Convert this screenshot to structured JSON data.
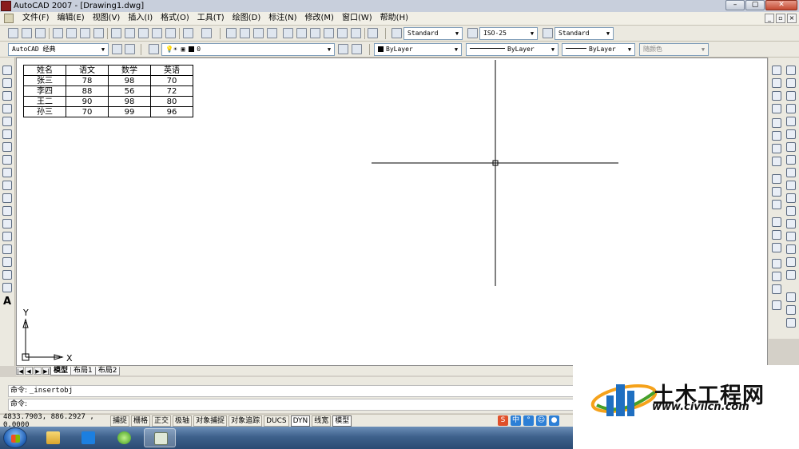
{
  "window": {
    "title": "AutoCAD 2007 - [Drawing1.dwg]",
    "min_label": "–",
    "max_label": "▢",
    "close_label": "✕"
  },
  "menu": {
    "items": [
      "文件(F)",
      "编辑(E)",
      "视图(V)",
      "插入(I)",
      "格式(O)",
      "工具(T)",
      "绘图(D)",
      "标注(N)",
      "修改(M)",
      "窗口(W)",
      "帮助(H)"
    ],
    "mdi": [
      "_",
      "▫",
      "×"
    ]
  },
  "toolbar_standard": {
    "text_style": "Standard",
    "dim_style": "ISO-25",
    "table_style": "Standard"
  },
  "toolbar_layers": {
    "workspace": "AutoCAD 经典",
    "layer": "0",
    "color": "ByLayer",
    "linetype": "ByLayer",
    "lineweight": "ByLayer",
    "plotstyle": "随颜色"
  },
  "drawing": {
    "table": {
      "rows": [
        [
          "姓名",
          "语文",
          "数学",
          "英语"
        ],
        [
          "张三",
          "78",
          "98",
          "70"
        ],
        [
          "李四",
          "88",
          "56",
          "72"
        ],
        [
          "王二",
          "90",
          "98",
          "80"
        ],
        [
          "孙三",
          "70",
          "99",
          "96"
        ]
      ]
    },
    "ucs_x": "X",
    "ucs_y": "Y"
  },
  "layout_tabs": [
    "模型",
    "布局1",
    "布局2"
  ],
  "nav_buttons": [
    "|◀",
    "◀",
    "▶",
    "▶|"
  ],
  "command": {
    "prompt_label": "命令:",
    "history": "_insertobj",
    "current": ""
  },
  "status": {
    "coords": "4833.7903, 886.2927 , 0.0000",
    "buttons": [
      "捕捉",
      "栅格",
      "正交",
      "极轴",
      "对象捕捉",
      "对象追踪",
      "DUCS",
      "DYN",
      "线宽",
      "模型"
    ],
    "on": [
      7,
      9
    ]
  },
  "watermark": {
    "cn": "土木工程网",
    "url": "www.civilcn.com"
  },
  "colors": {
    "accent_blue": "#1f6fc1",
    "logo_orange": "#f5a21b",
    "logo_green": "#45a02a"
  }
}
